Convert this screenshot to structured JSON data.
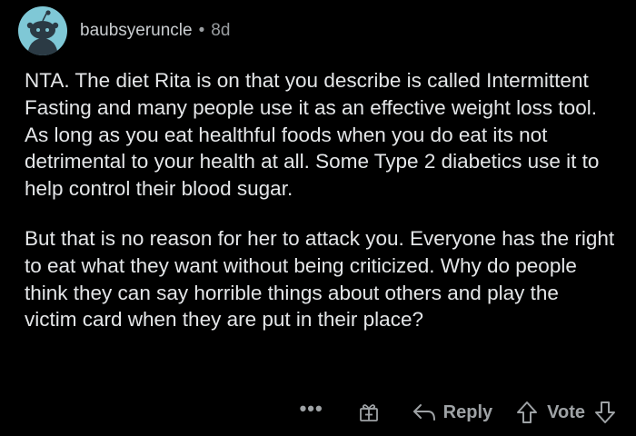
{
  "comment": {
    "author": "baubsyeruncle",
    "separator": "•",
    "age": "8d",
    "paragraphs": [
      "NTA. The diet Rita is on that you describe is called Intermittent Fasting and many people use it as an effective weight loss tool. As long as you eat healthful foods when you do eat its not detrimental to your health at all. Some Type 2 diabetics use it to help control their blood sugar.",
      "But that is no reason for her to attack you. Everyone has the right to eat what they want without being criticized. Why do people think they can say horrible things about others and play the victim card when they are put in their place?"
    ]
  },
  "actions": {
    "more": "•••",
    "reply_label": "Reply",
    "vote_label": "Vote"
  },
  "icons": {
    "avatar": "snoo-avatar-icon",
    "more": "more-options-icon",
    "award": "award-gift-icon",
    "reply": "reply-arrow-icon",
    "upvote": "upvote-arrow-icon",
    "downvote": "downvote-arrow-icon"
  },
  "colors": {
    "background": "#000000",
    "text": "#e4e6e8",
    "muted": "#9ea2a5",
    "avatar_bg": "#7fc8d6"
  }
}
